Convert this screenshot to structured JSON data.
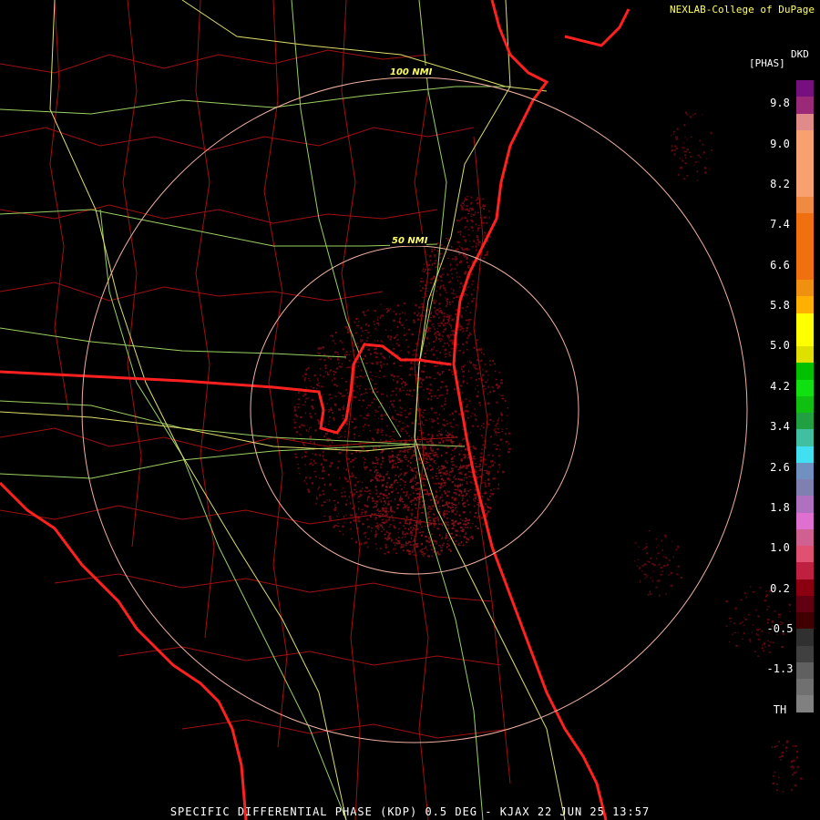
{
  "header": {
    "credit": "NEXLAB-College of DuPage",
    "product_code": "DKD",
    "units": "[PHAS]"
  },
  "range_rings": [
    {
      "label": "100 NMI"
    },
    {
      "label": "50 NMI"
    }
  ],
  "legend": {
    "labels": [
      "9.8",
      "9.0",
      "8.2",
      "7.4",
      "6.6",
      "5.8",
      "5.0",
      "4.2",
      "3.4",
      "2.6",
      "1.8",
      "1.0",
      "0.2",
      "-0.5",
      "-1.3",
      "TH"
    ],
    "colors": [
      "#77107f",
      "#9a2a78",
      "#e08a8a",
      "#f7a070",
      "#f7a070",
      "#f7a070",
      "#f7a070",
      "#f08a40",
      "#f07010",
      "#f07010",
      "#f07010",
      "#f07010",
      "#f09010",
      "#ffb000",
      "#ffff00",
      "#ffff00",
      "#e0e000",
      "#00c000",
      "#10e010",
      "#10c010",
      "#20a040",
      "#40c0a0",
      "#40e0f0",
      "#7090c0",
      "#8080b0",
      "#b070c0",
      "#e070d0",
      "#d06090",
      "#e05070",
      "#c02040",
      "#8a0010",
      "#600010",
      "#400000",
      "#303030",
      "#404040",
      "#606060",
      "#707070",
      "#808080",
      "#000000"
    ]
  },
  "footer": {
    "title": "SPECIFIC DIFFERENTIAL PHASE (KDP) 0.5 DEG - KJAX 22 JUN 25 13:57"
  }
}
